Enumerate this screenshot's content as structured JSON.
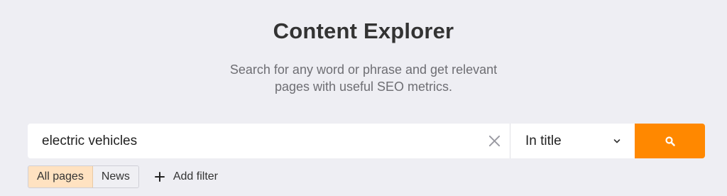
{
  "header": {
    "title": "Content Explorer",
    "subtitle_line1": "Search for any word or phrase and get relevant",
    "subtitle_line2": "pages with useful SEO metrics."
  },
  "search": {
    "value": "electric vehicles",
    "clear_icon": "close-icon",
    "mode": {
      "selected": "In title",
      "icon": "chevron-down-icon"
    },
    "submit_icon": "search-icon",
    "accent": "#ff8800"
  },
  "filters": {
    "tabs": [
      {
        "label": "All pages",
        "active": true
      },
      {
        "label": "News",
        "active": false
      }
    ],
    "add_filter_label": "Add filter",
    "add_icon": "plus-icon"
  },
  "colors": {
    "background": "#eeeef3",
    "active_tab": "#ffe2c1"
  }
}
